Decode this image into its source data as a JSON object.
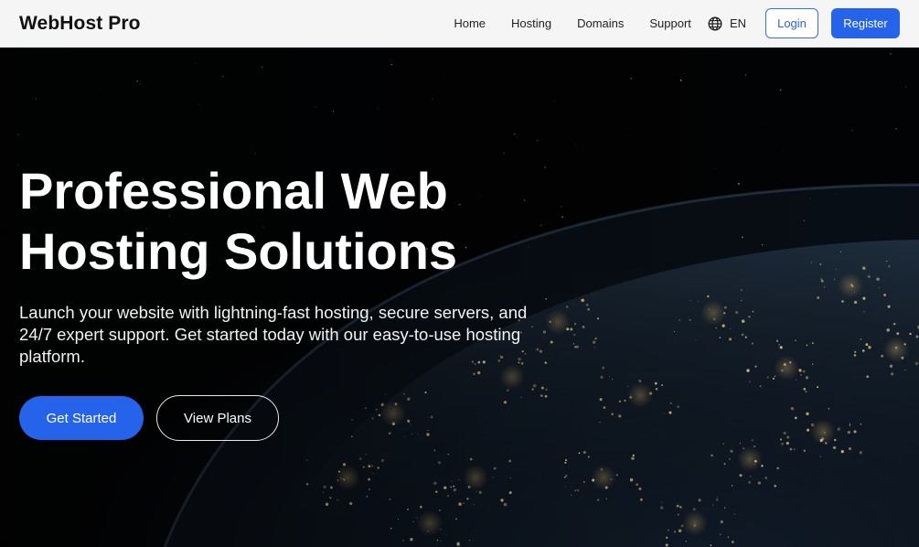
{
  "header": {
    "logo": "WebHost Pro",
    "nav": [
      "Home",
      "Hosting",
      "Domains",
      "Support"
    ],
    "language": "EN",
    "language_icon": "globe-icon",
    "login_label": "Login",
    "register_label": "Register"
  },
  "hero": {
    "title_line1": "Professional Web",
    "title_line2": "Hosting Solutions",
    "description": "Launch your website with lightning-fast hosting, secure servers, and 24/7 expert support. Get started today with our easy-to-use hosting platform.",
    "primary_cta": "Get Started",
    "secondary_cta": "View Plans"
  },
  "colors": {
    "accent": "#2563eb",
    "header_bg": "#f5f5f5",
    "hero_bg": "#020304"
  }
}
